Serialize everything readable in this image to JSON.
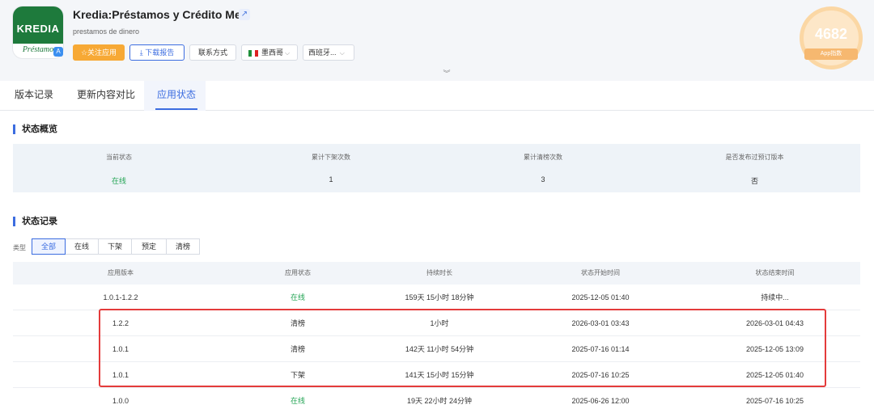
{
  "header": {
    "logo_word": "KREDIA",
    "logo_sub": "Préstamo",
    "title": "Kredia:Préstamos y Crédito Mex",
    "subtitle": "prestamos de dinero",
    "follow_label": "☆关注应用",
    "download_label": "⤓ 下载报告",
    "contact_label": "联系方式",
    "country_label": "墨西哥",
    "language_label": "西班牙...",
    "score": "4682",
    "score_label": "App指数"
  },
  "tabs": [
    {
      "label": "版本记录"
    },
    {
      "label": "更新内容对比"
    },
    {
      "label": "应用状态"
    }
  ],
  "overview": {
    "title": "状态概览",
    "columns": [
      {
        "label": "当前状态",
        "value": "在线"
      },
      {
        "label": "累计下架次数",
        "value": "1"
      },
      {
        "label": "累计清榜次数",
        "value": "3"
      },
      {
        "label": "是否发布过预订版本",
        "value": "否"
      }
    ]
  },
  "records": {
    "title": "状态记录",
    "filter_label": "类型",
    "filters": [
      "全部",
      "在线",
      "下架",
      "预定",
      "清榜"
    ],
    "headers": [
      "应用版本",
      "应用状态",
      "持续时长",
      "状态开始时间",
      "状态结束时间"
    ],
    "rows": [
      {
        "version": "1.0.1-1.2.2",
        "status": "在线",
        "duration": "159天 15小时 18分钟",
        "start": "2025-12-05 01:40",
        "end": "持续中..."
      },
      {
        "version": "1.2.2",
        "status": "清榜",
        "duration": "1小时",
        "start": "2026-03-01 03:43",
        "end": "2026-03-01 04:43"
      },
      {
        "version": "1.0.1",
        "status": "清榜",
        "duration": "142天 11小时 54分钟",
        "start": "2025-07-16 01:14",
        "end": "2025-12-05 13:09"
      },
      {
        "version": "1.0.1",
        "status": "下架",
        "duration": "141天 15小时 15分钟",
        "start": "2025-07-16 10:25",
        "end": "2025-12-05 01:40"
      },
      {
        "version": "1.0.0",
        "status": "在线",
        "duration": "19天 22小时 24分钟",
        "start": "2025-06-26 12:00",
        "end": "2025-07-16 10:25"
      }
    ]
  },
  "colors": {
    "accent": "#3c6de0",
    "online_green": "#23a454",
    "highlight_red": "#e43b3b",
    "follow_orange": "#f7a935"
  }
}
